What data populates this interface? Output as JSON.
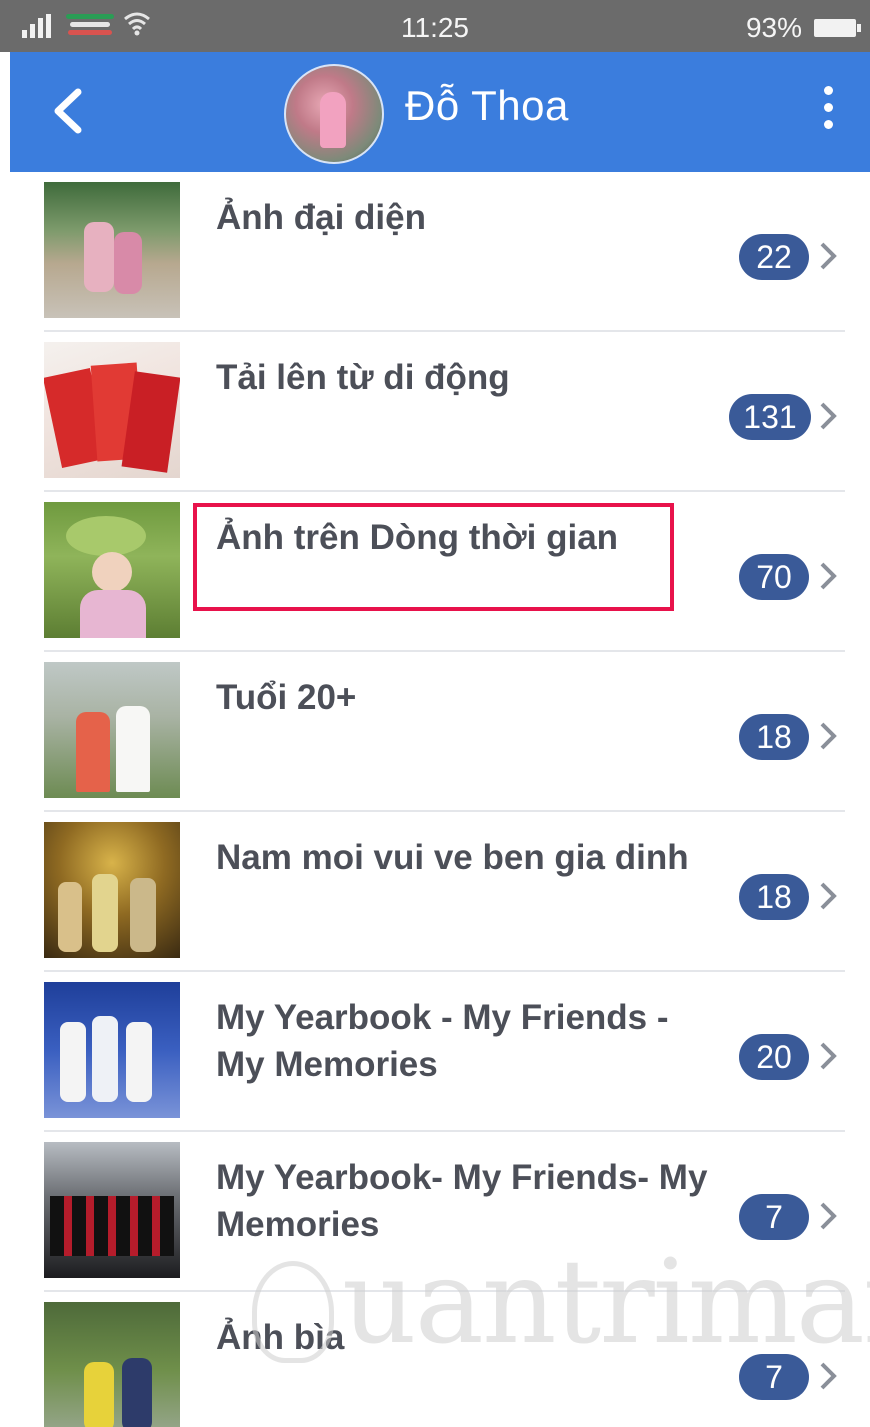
{
  "status_bar": {
    "time": "11:25",
    "battery": "93%"
  },
  "header": {
    "name": "Đỗ Thoa"
  },
  "albums": [
    {
      "title": "Ảnh đại diện",
      "count": "22"
    },
    {
      "title": "Tải lên từ di động",
      "count": "131"
    },
    {
      "title": "Ảnh trên Dòng thời gian",
      "count": "70"
    },
    {
      "title": "Tuổi 20+",
      "count": "18"
    },
    {
      "title": "Nam moi vui ve ben gia dinh",
      "count": "18"
    },
    {
      "title": "My Yearbook - My Friends - My Memories",
      "count": "20"
    },
    {
      "title": "My Yearbook- My Friends- My Memories",
      "count": "7"
    },
    {
      "title": "Ảnh bìa",
      "count": "7"
    }
  ],
  "watermark": "uantrimang",
  "colors": {
    "header_bg": "#3b7ddd",
    "badge_bg": "#3a5a98",
    "highlight": "#e8124b"
  }
}
